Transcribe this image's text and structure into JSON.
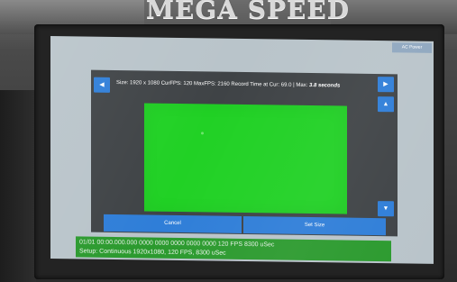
{
  "brand": {
    "name": "MEGA SPEED"
  },
  "screen": {
    "ac_power_label": "AC Power",
    "dialog": {
      "info_prefix": "Size: 1920 x 1080  CurFPS: 120  MaxFPS: 2160   Record Time at Cur: 69.0 | Max: ",
      "info_max_time": "3.8 seconds",
      "left_icon": "arrow-left-icon",
      "right_icon": "arrow-right-icon",
      "up_icon": "arrow-up-icon",
      "down_icon": "arrow-down-icon",
      "preview_color": "#21d125",
      "cancel_label": "Cancel",
      "set_size_label": "Set Size"
    },
    "status": {
      "line1": "01/01 00:00.000.000     0000   0000 0000 0000 0000      120 FPS  8300 uSec",
      "line2": "Setup: Continuous 1920x1080, 120 FPS, 8300 uSec"
    }
  },
  "colors": {
    "accent_blue": "#2f7ed8",
    "status_green": "#2b9a2e",
    "preview_green": "#21d125"
  }
}
